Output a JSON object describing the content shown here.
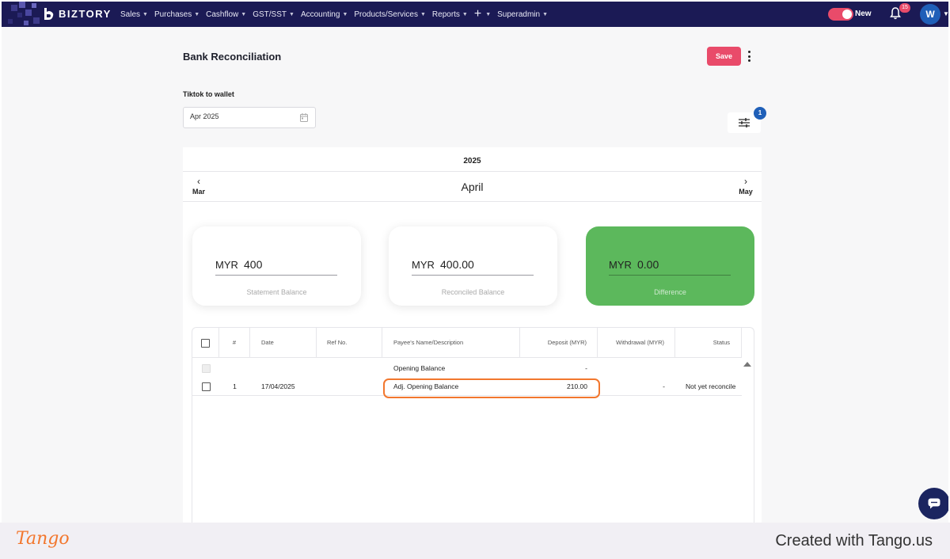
{
  "nav": {
    "brand": "BIZTORY",
    "menu": [
      {
        "label": "Sales"
      },
      {
        "label": "Purchases"
      },
      {
        "label": "Cashflow"
      },
      {
        "label": "GST/SST"
      },
      {
        "label": "Accounting"
      },
      {
        "label": "Products/Services"
      },
      {
        "label": "Reports"
      }
    ],
    "superadmin": "Superadmin",
    "toggle_label": "New",
    "notification_count": "15",
    "avatar_initial": "W",
    "colors": {
      "bar": "#1b1a55",
      "accent": "#e94b6a",
      "avatar": "#1f5fb8"
    }
  },
  "page": {
    "title": "Bank Reconciliation",
    "save_label": "Save",
    "account_label": "Tiktok to wallet",
    "period_value": "Apr 2025",
    "filter_count": "1"
  },
  "calendar": {
    "year": "2025",
    "prev_month": "Mar",
    "current_month": "April",
    "next_month": "May"
  },
  "balances": [
    {
      "currency": "MYR",
      "value": "400",
      "label": "Statement Balance"
    },
    {
      "currency": "MYR",
      "value": "400.00",
      "label": "Reconciled Balance"
    },
    {
      "currency": "MYR",
      "value": "0.00",
      "label": "Difference",
      "color": "#5cb85c"
    }
  ],
  "table": {
    "columns": {
      "num": "#",
      "date": "Date",
      "ref": "Ref No.",
      "payee": "Payee's Name/Description",
      "deposit": "Deposit (MYR)",
      "withdrawal": "Withdrawal (MYR)",
      "status": "Status"
    },
    "rows": [
      {
        "num": "",
        "date": "",
        "ref": "",
        "payee": "Opening Balance",
        "deposit": "-",
        "withdrawal": "",
        "status": ""
      },
      {
        "num": "1",
        "date": "17/04/2025",
        "ref": "",
        "payee": "Adj. Opening Balance",
        "deposit": "210.00",
        "withdrawal": "-",
        "status": "Not yet reconcile"
      }
    ]
  },
  "footer": {
    "logo": "Tango",
    "credit": "Created with Tango.us",
    "logo_color": "#f2772e"
  }
}
